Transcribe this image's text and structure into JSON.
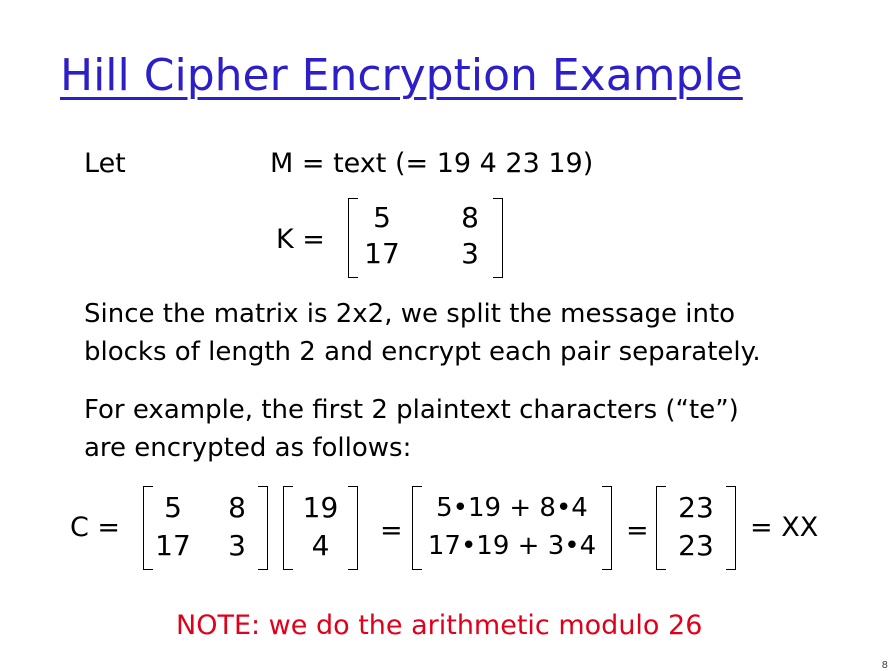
{
  "slide": {
    "title": "Hill Cipher Encryption Example",
    "let_label": "Let",
    "m_def": "M = text (= 19 4 23 19)",
    "k_label": "K =",
    "k_matrix": [
      [
        "5",
        "8"
      ],
      [
        "17",
        "3"
      ]
    ],
    "para1_line1": "Since the matrix is 2x2, we split the message into",
    "para1_line2": "blocks of length 2 and encrypt each pair separately.",
    "para2_line1": "For example, the first 2 plaintext characters (“te”)",
    "para2_line2": "are encrypted as follows:",
    "c_label": "C =",
    "eq_matrix": [
      [
        "5",
        "8"
      ],
      [
        "17",
        "3"
      ]
    ],
    "eq_vector": [
      "19",
      "4"
    ],
    "equals": "=",
    "products": [
      "5•19 + 8•4",
      "17•19 + 3•4"
    ],
    "result": [
      "23",
      "23"
    ],
    "final": "= XX",
    "note": "NOTE: we do the arithmetic modulo 26",
    "page_mark": "8"
  },
  "colors": {
    "title": "#2d1fc8",
    "note": "#e0001a"
  }
}
